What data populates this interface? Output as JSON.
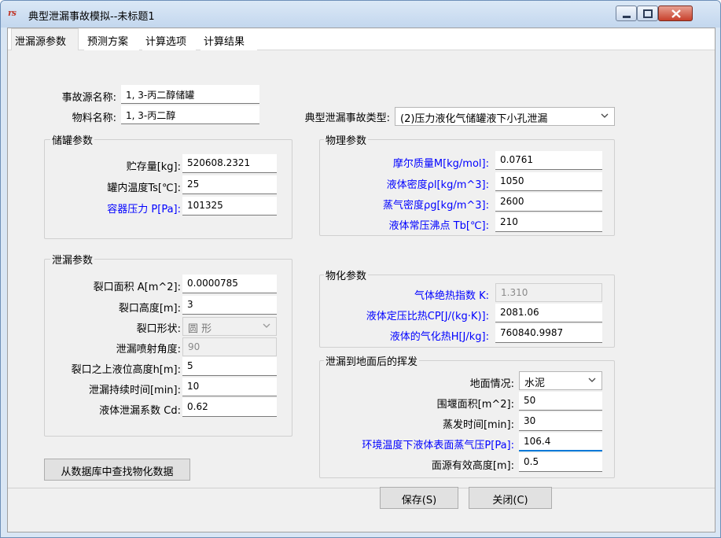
{
  "window": {
    "title": "典型泄漏事故模拟--未标题1",
    "icon_text": "rs"
  },
  "tabs": [
    "泄漏源参数",
    "预测方案",
    "计算选项",
    "计算结果"
  ],
  "source": {
    "name_label": "事故源名称:",
    "name_value": "1, 3-丙二醇储罐",
    "material_label": "物料名称:",
    "material_value": "1, 3-丙二醇",
    "type_label": "典型泄漏事故类型:",
    "type_value": "(2)压力液化气储罐液下小孔泄漏"
  },
  "tank": {
    "title": "储罐参数",
    "storage_label": "贮存量[kg]:",
    "storage_value": "520608.2321",
    "temp_label": "罐内温度Ts[℃]:",
    "temp_value": "25",
    "pressure_label": "容器压力 P[Pa]:",
    "pressure_value": "101325"
  },
  "leak": {
    "title": "泄漏参数",
    "area_label": "裂口面积 A[m^2]:",
    "area_value": "0.0000785",
    "height_label": "裂口高度[m]:",
    "height_value": "3",
    "shape_label": "裂口形状:",
    "shape_value": "圆  形",
    "angle_label": "泄漏喷射角度:",
    "angle_value": "90",
    "level_label": "裂口之上液位高度h[m]:",
    "level_value": "5",
    "duration_label": "泄漏持续时间[min]:",
    "duration_value": "10",
    "cd_label": "液体泄漏系数  Cd:",
    "cd_value": "0.62"
  },
  "physical": {
    "title": "物理参数",
    "molar_label": "摩尔质量M[kg/mol]:",
    "molar_value": "0.0761",
    "liquid_density_label": "液体密度ρl[kg/m^3]:",
    "liquid_density_value": "1050",
    "vapor_density_label": "蒸气密度ρg[kg/m^3]:",
    "vapor_density_value": "2600",
    "boiling_label": "液体常压沸点 Tb[℃]:",
    "boiling_value": "210"
  },
  "chemical": {
    "title": "物化参数",
    "k_label": "气体绝热指数  K:",
    "k_value": "1.310",
    "cp_label": "液体定压比热CP[J/(kg·K)]:",
    "cp_value": "2081.06",
    "h_label": "液体的气化热H[J/kg]:",
    "h_value": "760840.9987"
  },
  "ground": {
    "title": "泄漏到地面后的挥发",
    "surface_label": "地面情况:",
    "surface_value": "水泥",
    "dike_label": "围堰面积[m^2]:",
    "dike_value": "50",
    "evap_label": "蒸发时间[min]:",
    "evap_value": "30",
    "vp_label": "环境温度下液体表面蒸气压P[Pa]:",
    "vp_value": "106.4",
    "height_label": "面源有效高度[m]:",
    "height_value": "0.5"
  },
  "buttons": {
    "lookup": "从数据库中查找物化数据",
    "save": "保存(S)",
    "close": "关闭(C)"
  },
  "colors": {
    "accent_blue_label": "#0000ff",
    "focus_underline": "#0078d7"
  }
}
